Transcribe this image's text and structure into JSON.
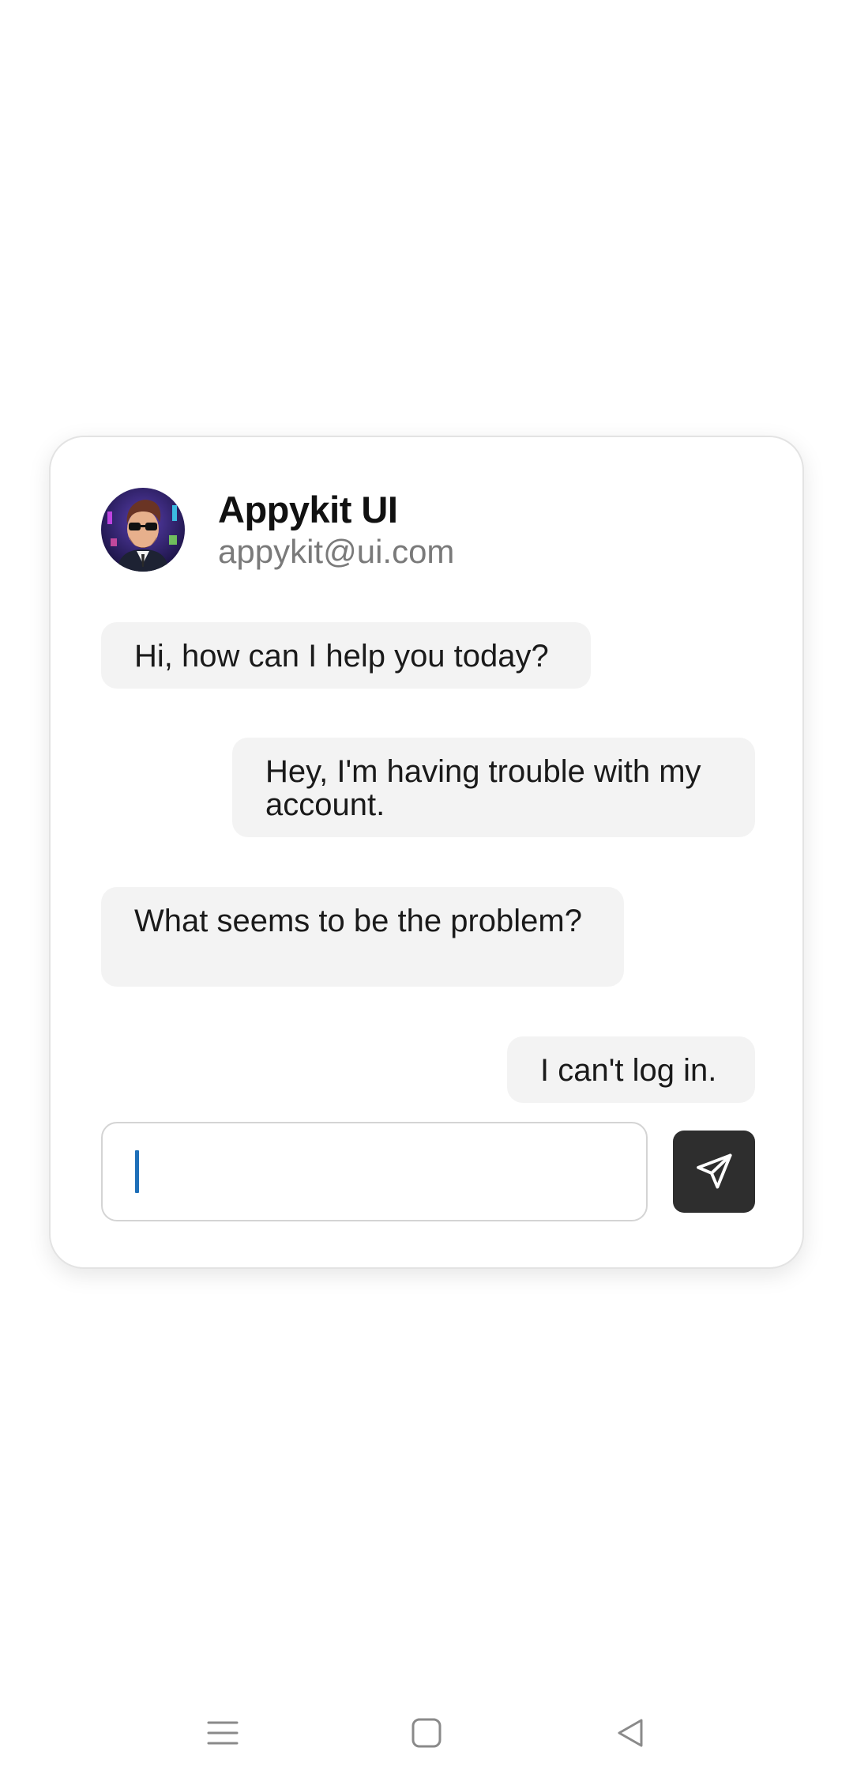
{
  "profile": {
    "name": "Appykit UI",
    "email": "appykit@ui.com",
    "avatar_icon": "avatar-man-sunglasses"
  },
  "messages": [
    {
      "sender": "agent",
      "text": "Hi, how can I help you today?"
    },
    {
      "sender": "user",
      "text": "Hey, I'm having trouble with my account."
    },
    {
      "sender": "agent",
      "text": "What seems to be the problem?"
    },
    {
      "sender": "user",
      "text": "I can't log in."
    }
  ],
  "composer": {
    "value": "",
    "placeholder": "",
    "send_icon": "send-icon"
  },
  "colors": {
    "bubble_bg": "#f3f3f3",
    "send_button_bg": "#2e2e2e",
    "caret": "#1e6fb8"
  },
  "system_nav": {
    "icons": [
      "menu-icon",
      "home-icon",
      "back-icon"
    ]
  }
}
